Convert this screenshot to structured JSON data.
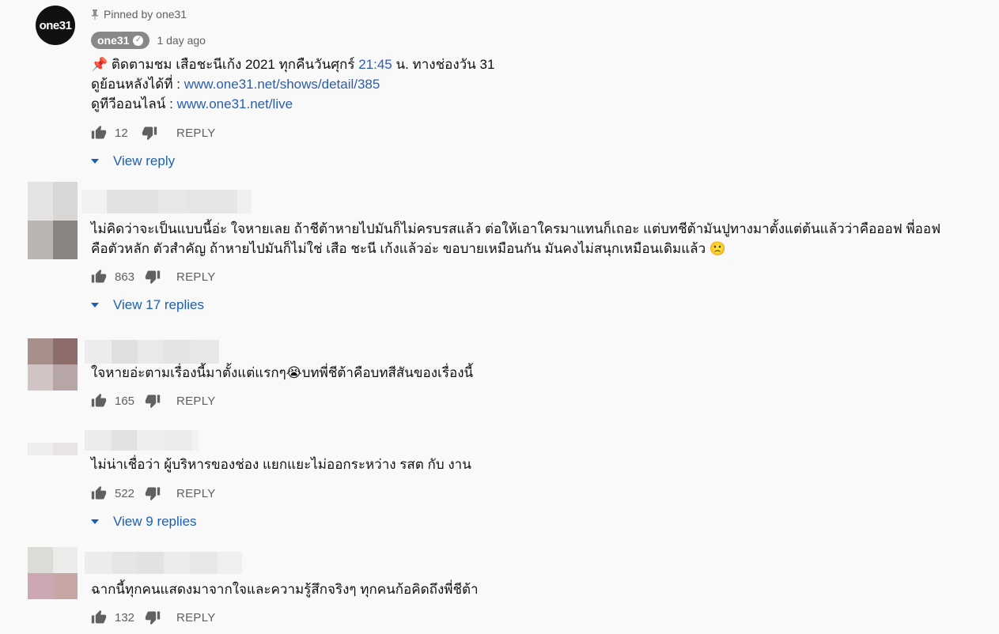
{
  "pinned_comment": {
    "avatar_text": "one31",
    "pinned_label": "Pinned by one31",
    "author": "one31",
    "timestamp": "1 day ago",
    "line1_prefix": "📌 ติดตามชม เสือชะนีเก้ง 2021 ทุกคืนวันศุกร์ ",
    "line1_time": "21:45",
    "line1_suffix": " น. ทางช่องวัน 31",
    "line2_prefix": "ดูย้อนหลังได้ที่ : ",
    "line2_link": "www.one31.net/shows/detail/385",
    "line3_prefix": "ดูทีวีออนไลน์ : ",
    "line3_link": "www.one31.net/live",
    "likes": "12",
    "reply_label": "REPLY",
    "view_replies": "View reply"
  },
  "comments": [
    {
      "text_line1": "ไม่คิดว่าจะเป็นแบบนี้อ่ะ ใจหายเลย ถ้าชีต้าหายไปมันก็ไม่ครบรสแล้ว ต่อให้เอาใครมาแทนก็เถอะ แต่บทชีต้ามันปูทางมาตั้งแต่ต้นแล้วว่าคือออฟ พี่ออฟ",
      "text_line2": "คือตัวหลัก ตัวสำคัญ ถ้าหายไปมันก็ไม่ใช่ เสือ ชะนี เก้งแล้วอ่ะ ขอบายเหมือนกัน มันคงไม่สนุกเหมือนเดิมแล้ว 🙁",
      "likes": "863",
      "reply_label": "REPLY",
      "view_replies": "View 17 replies"
    },
    {
      "text_line1": "ใจหายอ่ะตามเรื่องนี้มาตั้งแต่แรกๆ😭บทพี่ชีต้าคือบทสีสันของเรื่องนี้",
      "likes": "165",
      "reply_label": "REPLY"
    },
    {
      "text_line1": "ไม่น่าเชื่อว่า ผู้บริหารของช่อง แยกแยะไม่ออกระหว่าง รสต กับ งาน",
      "likes": "522",
      "reply_label": "REPLY",
      "view_replies": "View 9 replies"
    },
    {
      "text_line1": "ฉากนี้ทุกคนแสดงมาจากใจและความรู้สึกจริงๆ ทุกคนก้อคิดถึงพี่ชีต้า",
      "likes": "132",
      "reply_label": "REPLY"
    }
  ],
  "colors": {
    "background": "#f9f9f9",
    "link": "#2a5db0",
    "view_replies": "#1a5fb4",
    "secondary_text": "#606060"
  },
  "icons": [
    "pin-icon",
    "verified-check-icon",
    "like-icon",
    "dislike-icon",
    "caret-down-icon"
  ]
}
